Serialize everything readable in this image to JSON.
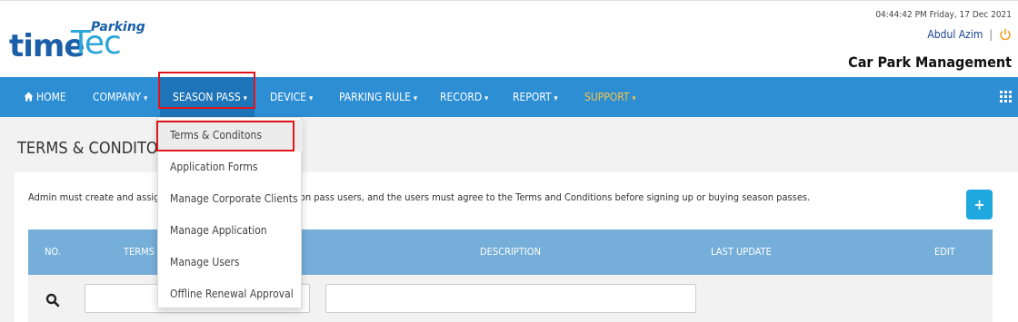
{
  "logo": {
    "time": "time",
    "tec": "Tec",
    "parking": "Parking"
  },
  "header": {
    "datetime": "04:44:42 PM Friday, 17 Dec 2021",
    "user_name": "Abdul Azim",
    "separator": "|",
    "app_title": "Car Park Management"
  },
  "nav": {
    "items": [
      {
        "label": "HOME",
        "icon": "home-icon"
      },
      {
        "label": "COMPANY"
      },
      {
        "label": "SEASON PASS",
        "active": true
      },
      {
        "label": "DEVICE"
      },
      {
        "label": "PARKING RULE"
      },
      {
        "label": "RECORD"
      },
      {
        "label": "REPORT"
      },
      {
        "label": "SUPPORT",
        "color": "#f6c34b"
      }
    ],
    "caret": "▾",
    "apps_icon": "grid-icon"
  },
  "page": {
    "title": "TERMS & CONDITONS",
    "description": "Admin must create and assign Terms and Conditions to season pass users, and the users must agree to the Terms and Conditions before signing up or buying season passes.",
    "add_label": "+"
  },
  "table": {
    "columns": [
      "NO.",
      "TERMS",
      "DESCRIPTION",
      "LAST UPDATE",
      "EDIT"
    ]
  },
  "dropdown": {
    "items": [
      "Terms & Conditons",
      "Application Forms",
      "Manage Corporate Clients",
      "Manage Application",
      "Manage Users",
      "Offline Renewal Approval"
    ],
    "selected_index": 0
  },
  "colors": {
    "nav_bg": "#2d8ed4",
    "nav_active": "#1e74b8",
    "table_header": "#75aed8",
    "highlight": "#e0161b",
    "add_button": "#1fa7e0"
  }
}
